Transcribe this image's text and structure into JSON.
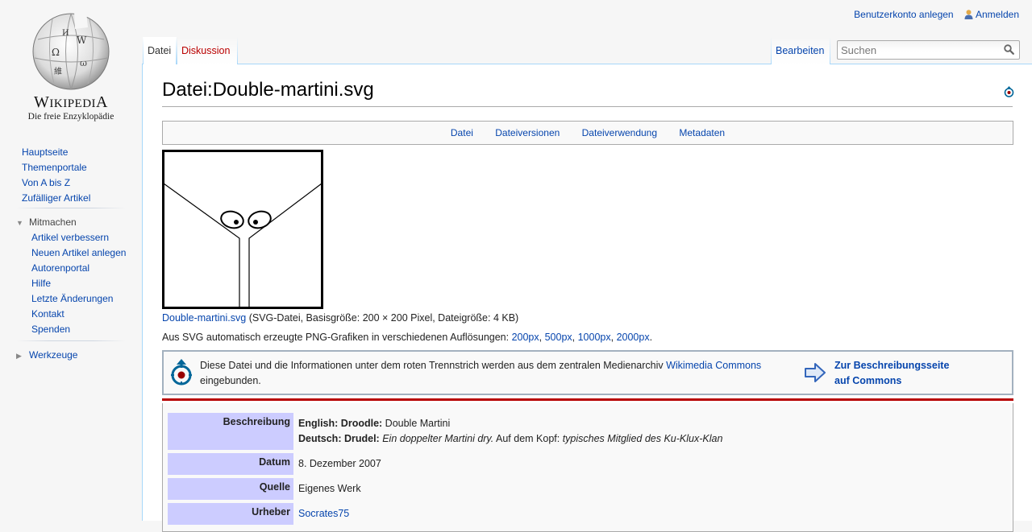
{
  "logo": {
    "wordmark_main": "Wikipedi",
    "wordmark_last": "A",
    "wordmark_first": "W",
    "slogan": "Die freie Enzyklopädie"
  },
  "personal": {
    "create_account": "Benutzerkonto anlegen",
    "login": "Anmelden"
  },
  "tabs": {
    "datei": "Datei",
    "diskussion": "Diskussion",
    "edit": "Bearbeiten"
  },
  "search": {
    "placeholder": "Suchen"
  },
  "nav": {
    "main": [
      "Hauptseite",
      "Themenportale",
      "Von A bis Z",
      "Zufälliger Artikel"
    ],
    "mitmachen_title": "Mitmachen",
    "mitmachen": [
      "Artikel verbessern",
      "Neuen Artikel anlegen",
      "Autorenportal",
      "Hilfe",
      "Letzte Änderungen",
      "Kontakt",
      "Spenden"
    ],
    "werkzeuge_title": "Werkzeuge"
  },
  "page": {
    "title": "Datei:Double-martini.svg",
    "toc": [
      "Datei",
      "Dateiversionen",
      "Dateiverwendung",
      "Metadaten"
    ],
    "file_link": "Double-martini.svg",
    "file_meta": " (SVG-Datei, Basisgröße: 200 × 200 Pixel, Dateigröße: 4 KB)",
    "res_prefix": "Aus SVG automatisch erzeugte PNG-Grafiken in verschiedenen Auflösungen: ",
    "resolutions": [
      "200px",
      "500px",
      "1000px",
      "2000px"
    ],
    "shared": {
      "msg_before": "Diese Datei und die Informationen unter dem roten Trennstrich werden aus dem zentralen Medienarchiv ",
      "msg_link": "Wikimedia Commons",
      "msg_after": " eingebunden.",
      "goto_line1": "Zur Beschreibungsseite",
      "goto_line2": "auf Commons"
    },
    "info": {
      "beschreibung_label": "Beschreibung",
      "en_lang": "English:",
      "en_term": "Droodle:",
      "en_text": " Double Martini",
      "de_lang": "Deutsch:",
      "de_term": "Drudel:",
      "de_italic1": "Ein doppelter Martini dry.",
      "de_mid": " Auf dem Kopf: ",
      "de_italic2": "typisches Mitglied des Ku-Klux-Klan",
      "datum_label": "Datum",
      "datum": "8. Dezember 2007",
      "quelle_label": "Quelle",
      "quelle": "Eigenes Werk",
      "urheber_label": "Urheber",
      "urheber": "Socrates75"
    }
  },
  "colors": {
    "link": "#0645ad",
    "new_link": "#ba0000",
    "info_label_bg": "#ccccff",
    "red_rule": "#b70000"
  }
}
